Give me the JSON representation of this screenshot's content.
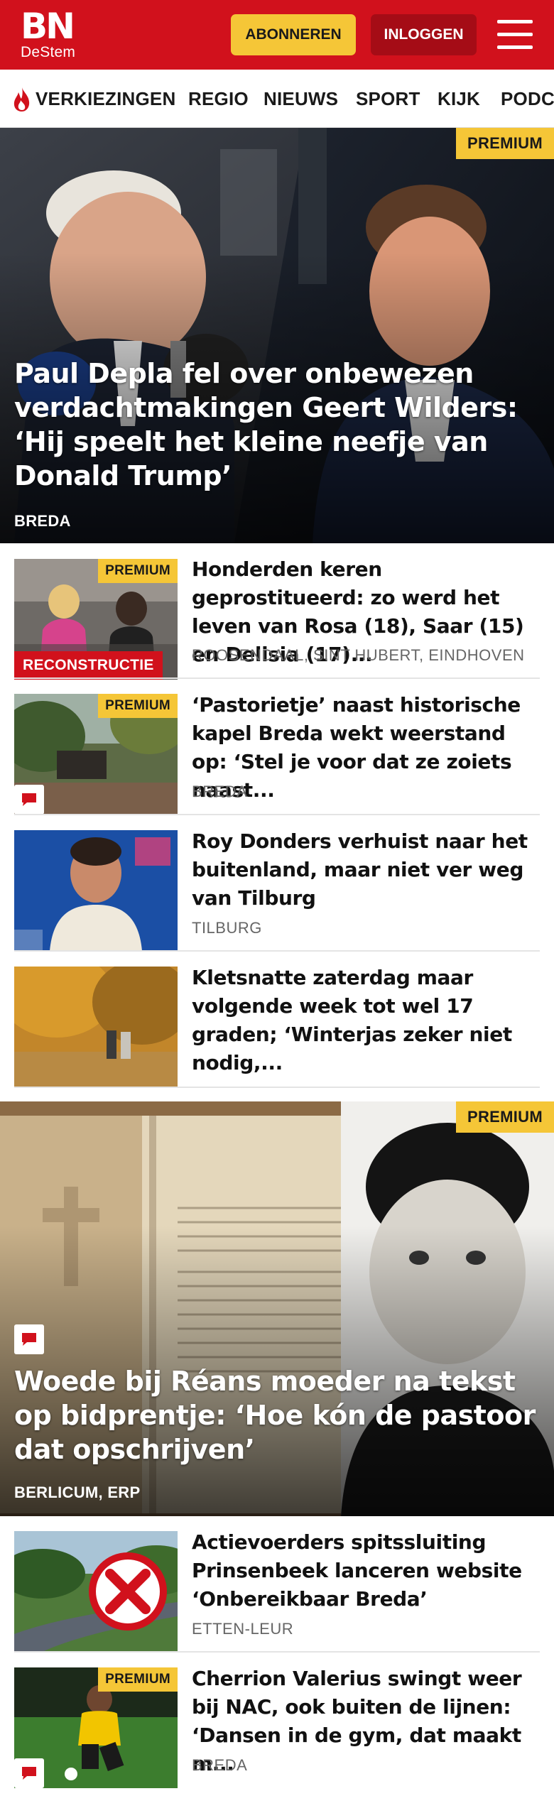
{
  "header": {
    "logo_main": "BN",
    "logo_sub": "DeStem",
    "subscribe_label": "ABONNEREN",
    "login_label": "INLOGGEN",
    "brand_color": "#d1111c",
    "accent_color": "#f5c637"
  },
  "nav": {
    "items": [
      "VERKIEZINGEN",
      "REGIO",
      "NIEUWS",
      "SPORT",
      "KIJK",
      "PODCASTS"
    ],
    "first_icon": "fire-icon"
  },
  "premium_label": "PREMIUM",
  "hero": {
    "title": "Paul Depla fel over onbewezen verdachtmakingen Geert Wilders: ‘Hij speelt het kleine neefje van Donald Trump’",
    "location": "BREDA"
  },
  "articles": [
    {
      "title": "Honderden keren geprostitueerd: zo werd het leven van Rosa (18), Saar (15) en Delisia (17)...",
      "location": "ROOSENDAAL, SINT HUBERT, EINDHOVEN",
      "tag": "RECONSTRUCTIE"
    },
    {
      "title": "‘Pastorietje’ naast historische kapel Breda wekt weerstand op: ‘Stel je voor dat ze zoiets naast...",
      "location": "BREDA"
    },
    {
      "title": "Roy Donders verhuist naar het buitenland, maar niet ver weg van Tilburg",
      "location": "TILBURG"
    },
    {
      "title": "Kletsnatte zaterdag maar volgende week tot wel 17 graden; ‘Winterjas zeker niet nodig,..."
    }
  ],
  "hero2": {
    "title": "Woede bij Réans moeder na tekst op bidprentje: ‘Hoe kón de pastoor dat opschrijven’",
    "location": "BERLICUM, ERP"
  },
  "articles2": [
    {
      "title": "Actievoerders spitssluiting Prinsenbeek lanceren website ‘Onbereikbaar Breda’",
      "location": "ETTEN-LEUR"
    },
    {
      "title": "Cherrion Valerius swingt weer bij NAC, ook buiten de lijnen: ‘Dansen in de gym, dat maakt m...",
      "location": "BREDA"
    }
  ]
}
